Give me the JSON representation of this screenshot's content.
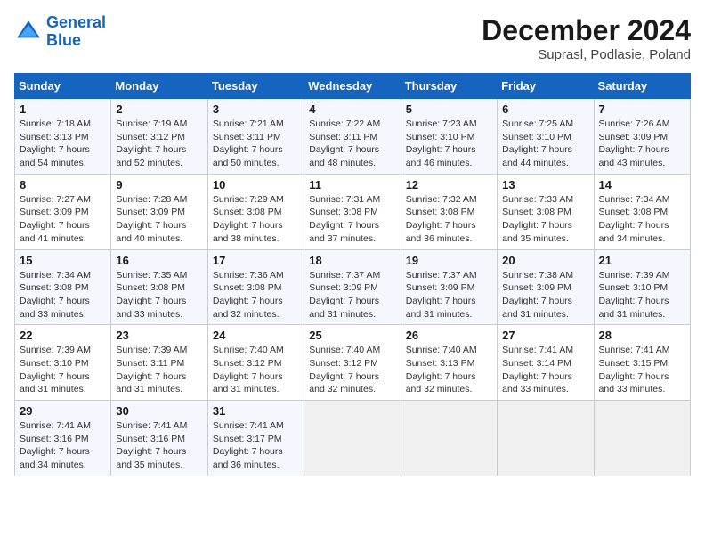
{
  "header": {
    "logo_line1": "General",
    "logo_line2": "Blue",
    "month": "December 2024",
    "location": "Suprasl, Podlasie, Poland"
  },
  "weekdays": [
    "Sunday",
    "Monday",
    "Tuesday",
    "Wednesday",
    "Thursday",
    "Friday",
    "Saturday"
  ],
  "weeks": [
    [
      {
        "day": "1",
        "sunrise": "Sunrise: 7:18 AM",
        "sunset": "Sunset: 3:13 PM",
        "daylight": "Daylight: 7 hours and 54 minutes."
      },
      {
        "day": "2",
        "sunrise": "Sunrise: 7:19 AM",
        "sunset": "Sunset: 3:12 PM",
        "daylight": "Daylight: 7 hours and 52 minutes."
      },
      {
        "day": "3",
        "sunrise": "Sunrise: 7:21 AM",
        "sunset": "Sunset: 3:11 PM",
        "daylight": "Daylight: 7 hours and 50 minutes."
      },
      {
        "day": "4",
        "sunrise": "Sunrise: 7:22 AM",
        "sunset": "Sunset: 3:11 PM",
        "daylight": "Daylight: 7 hours and 48 minutes."
      },
      {
        "day": "5",
        "sunrise": "Sunrise: 7:23 AM",
        "sunset": "Sunset: 3:10 PM",
        "daylight": "Daylight: 7 hours and 46 minutes."
      },
      {
        "day": "6",
        "sunrise": "Sunrise: 7:25 AM",
        "sunset": "Sunset: 3:10 PM",
        "daylight": "Daylight: 7 hours and 44 minutes."
      },
      {
        "day": "7",
        "sunrise": "Sunrise: 7:26 AM",
        "sunset": "Sunset: 3:09 PM",
        "daylight": "Daylight: 7 hours and 43 minutes."
      }
    ],
    [
      {
        "day": "8",
        "sunrise": "Sunrise: 7:27 AM",
        "sunset": "Sunset: 3:09 PM",
        "daylight": "Daylight: 7 hours and 41 minutes."
      },
      {
        "day": "9",
        "sunrise": "Sunrise: 7:28 AM",
        "sunset": "Sunset: 3:09 PM",
        "daylight": "Daylight: 7 hours and 40 minutes."
      },
      {
        "day": "10",
        "sunrise": "Sunrise: 7:29 AM",
        "sunset": "Sunset: 3:08 PM",
        "daylight": "Daylight: 7 hours and 38 minutes."
      },
      {
        "day": "11",
        "sunrise": "Sunrise: 7:31 AM",
        "sunset": "Sunset: 3:08 PM",
        "daylight": "Daylight: 7 hours and 37 minutes."
      },
      {
        "day": "12",
        "sunrise": "Sunrise: 7:32 AM",
        "sunset": "Sunset: 3:08 PM",
        "daylight": "Daylight: 7 hours and 36 minutes."
      },
      {
        "day": "13",
        "sunrise": "Sunrise: 7:33 AM",
        "sunset": "Sunset: 3:08 PM",
        "daylight": "Daylight: 7 hours and 35 minutes."
      },
      {
        "day": "14",
        "sunrise": "Sunrise: 7:34 AM",
        "sunset": "Sunset: 3:08 PM",
        "daylight": "Daylight: 7 hours and 34 minutes."
      }
    ],
    [
      {
        "day": "15",
        "sunrise": "Sunrise: 7:34 AM",
        "sunset": "Sunset: 3:08 PM",
        "daylight": "Daylight: 7 hours and 33 minutes."
      },
      {
        "day": "16",
        "sunrise": "Sunrise: 7:35 AM",
        "sunset": "Sunset: 3:08 PM",
        "daylight": "Daylight: 7 hours and 33 minutes."
      },
      {
        "day": "17",
        "sunrise": "Sunrise: 7:36 AM",
        "sunset": "Sunset: 3:08 PM",
        "daylight": "Daylight: 7 hours and 32 minutes."
      },
      {
        "day": "18",
        "sunrise": "Sunrise: 7:37 AM",
        "sunset": "Sunset: 3:09 PM",
        "daylight": "Daylight: 7 hours and 31 minutes."
      },
      {
        "day": "19",
        "sunrise": "Sunrise: 7:37 AM",
        "sunset": "Sunset: 3:09 PM",
        "daylight": "Daylight: 7 hours and 31 minutes."
      },
      {
        "day": "20",
        "sunrise": "Sunrise: 7:38 AM",
        "sunset": "Sunset: 3:09 PM",
        "daylight": "Daylight: 7 hours and 31 minutes."
      },
      {
        "day": "21",
        "sunrise": "Sunrise: 7:39 AM",
        "sunset": "Sunset: 3:10 PM",
        "daylight": "Daylight: 7 hours and 31 minutes."
      }
    ],
    [
      {
        "day": "22",
        "sunrise": "Sunrise: 7:39 AM",
        "sunset": "Sunset: 3:10 PM",
        "daylight": "Daylight: 7 hours and 31 minutes."
      },
      {
        "day": "23",
        "sunrise": "Sunrise: 7:39 AM",
        "sunset": "Sunset: 3:11 PM",
        "daylight": "Daylight: 7 hours and 31 minutes."
      },
      {
        "day": "24",
        "sunrise": "Sunrise: 7:40 AM",
        "sunset": "Sunset: 3:12 PM",
        "daylight": "Daylight: 7 hours and 31 minutes."
      },
      {
        "day": "25",
        "sunrise": "Sunrise: 7:40 AM",
        "sunset": "Sunset: 3:12 PM",
        "daylight": "Daylight: 7 hours and 32 minutes."
      },
      {
        "day": "26",
        "sunrise": "Sunrise: 7:40 AM",
        "sunset": "Sunset: 3:13 PM",
        "daylight": "Daylight: 7 hours and 32 minutes."
      },
      {
        "day": "27",
        "sunrise": "Sunrise: 7:41 AM",
        "sunset": "Sunset: 3:14 PM",
        "daylight": "Daylight: 7 hours and 33 minutes."
      },
      {
        "day": "28",
        "sunrise": "Sunrise: 7:41 AM",
        "sunset": "Sunset: 3:15 PM",
        "daylight": "Daylight: 7 hours and 33 minutes."
      }
    ],
    [
      {
        "day": "29",
        "sunrise": "Sunrise: 7:41 AM",
        "sunset": "Sunset: 3:16 PM",
        "daylight": "Daylight: 7 hours and 34 minutes."
      },
      {
        "day": "30",
        "sunrise": "Sunrise: 7:41 AM",
        "sunset": "Sunset: 3:16 PM",
        "daylight": "Daylight: 7 hours and 35 minutes."
      },
      {
        "day": "31",
        "sunrise": "Sunrise: 7:41 AM",
        "sunset": "Sunset: 3:17 PM",
        "daylight": "Daylight: 7 hours and 36 minutes."
      },
      null,
      null,
      null,
      null
    ]
  ]
}
